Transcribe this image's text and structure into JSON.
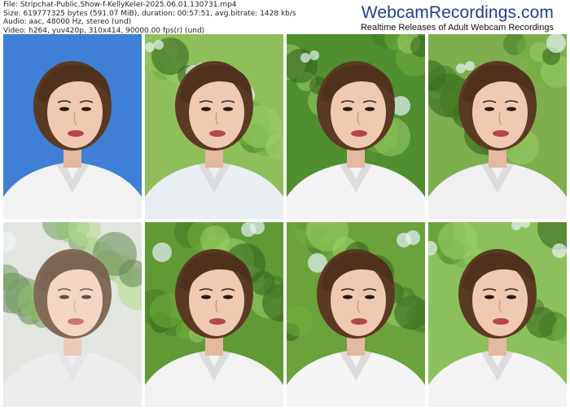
{
  "file_info": {
    "file": "File: Stripchat-Public.Show-f-KellyKeler-2025.06.01.130731.mp4",
    "size": "Size: 619777325 bytes (591.07 MiB), duration: 00:57:51, avg.bitrate: 1428 kb/s",
    "audio": "Audio: aac, 48000 Hz, stereo (und)",
    "video": "Video: h264, yuv420p, 310x414, 90000.00 fps(r) (und)"
  },
  "watermark": {
    "title": "WebcamRecordings.com",
    "subtitle": "Realtime Releases of Adult Webcam Recordings",
    "title_color": "#1f3f93"
  },
  "thumbnails": [
    {
      "scene": "sky-blue background",
      "bg": "#3f7fd6",
      "shirt": "#f2f2f2"
    },
    {
      "scene": "tree canopy low angle",
      "bg": "#8fbf5a",
      "shirt": "#e9eef2"
    },
    {
      "scene": "forest background",
      "bg": "#4f8f2f",
      "shirt": "#f4f4f4"
    },
    {
      "scene": "close-up with trees",
      "bg": "#7fae4f",
      "shirt": "#f0f0f0"
    },
    {
      "scene": "motion blur",
      "bg": "#d8ddd6",
      "shirt": "#e7e7e7"
    },
    {
      "scene": "forest close-up",
      "bg": "#5f9a35",
      "shirt": "#f2f2f2"
    },
    {
      "scene": "tree background",
      "bg": "#6aa23b",
      "shirt": "#f5f5f5"
    },
    {
      "scene": "bright trees",
      "bg": "#8bc05c",
      "shirt": "#f3f3f3"
    }
  ]
}
